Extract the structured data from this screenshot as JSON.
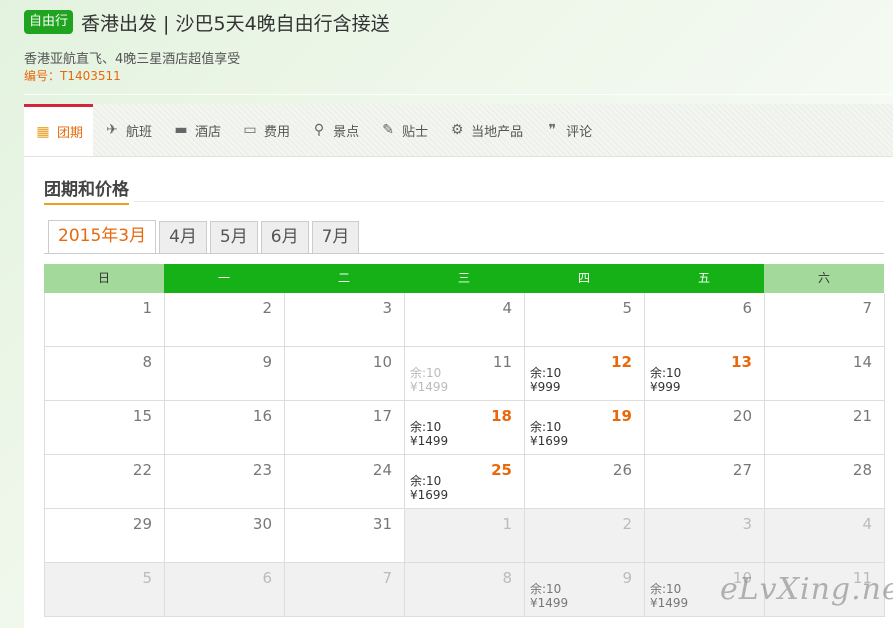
{
  "header": {
    "badge": "自由行",
    "title": "香港出发 | 沙巴5天4晚自由行含接送",
    "subtitle": "香港亚航直飞、4晚三星酒店超值享受",
    "code": "编号：T1403511"
  },
  "tabs": [
    {
      "label": "团期",
      "icon": "calendar-icon"
    },
    {
      "label": "航班",
      "icon": "plane-icon"
    },
    {
      "label": "酒店",
      "icon": "bed-icon"
    },
    {
      "label": "费用",
      "icon": "wallet-icon"
    },
    {
      "label": "景点",
      "icon": "location-pin-icon"
    },
    {
      "label": "贴士",
      "icon": "tips-icon"
    },
    {
      "label": "当地产品",
      "icon": "local-product-icon"
    },
    {
      "label": "评论",
      "icon": "comment-icon"
    }
  ],
  "section": {
    "title": "团期和价格"
  },
  "months": [
    "2015年3月",
    "4月",
    "5月",
    "6月",
    "7月"
  ],
  "weekdays": [
    "日",
    "一",
    "二",
    "三",
    "四",
    "五",
    "六"
  ],
  "calendar": {
    "rows": [
      [
        {
          "day": "1"
        },
        {
          "day": "2"
        },
        {
          "day": "3"
        },
        {
          "day": "4"
        },
        {
          "day": "5"
        },
        {
          "day": "6"
        },
        {
          "day": "7"
        }
      ],
      [
        {
          "day": "8"
        },
        {
          "day": "9"
        },
        {
          "day": "10"
        },
        {
          "day": "11",
          "status": "past",
          "remain": "余:10",
          "price": "¥1499"
        },
        {
          "day": "12",
          "status": "avail",
          "remain": "余:10",
          "price": "¥999"
        },
        {
          "day": "13",
          "status": "avail",
          "remain": "余:10",
          "price": "¥999"
        },
        {
          "day": "14"
        }
      ],
      [
        {
          "day": "15"
        },
        {
          "day": "16"
        },
        {
          "day": "17"
        },
        {
          "day": "18",
          "status": "avail",
          "remain": "余:10",
          "price": "¥1499"
        },
        {
          "day": "19",
          "status": "avail",
          "remain": "余:10",
          "price": "¥1699"
        },
        {
          "day": "20"
        },
        {
          "day": "21"
        }
      ],
      [
        {
          "day": "22"
        },
        {
          "day": "23"
        },
        {
          "day": "24"
        },
        {
          "day": "25",
          "status": "avail",
          "remain": "余:10",
          "price": "¥1699"
        },
        {
          "day": "26"
        },
        {
          "day": "27"
        },
        {
          "day": "28"
        }
      ],
      [
        {
          "day": "29"
        },
        {
          "day": "30"
        },
        {
          "day": "31"
        },
        {
          "day": "1",
          "other": true
        },
        {
          "day": "2",
          "other": true
        },
        {
          "day": "3",
          "other": true
        },
        {
          "day": "4",
          "other": true
        }
      ],
      [
        {
          "day": "5",
          "other": true
        },
        {
          "day": "6",
          "other": true
        },
        {
          "day": "7",
          "other": true
        },
        {
          "day": "8",
          "other": true
        },
        {
          "day": "9",
          "other": true,
          "remain": "余:10",
          "price": "¥1499"
        },
        {
          "day": "10",
          "other": true,
          "remain": "余:10",
          "price": "¥1499"
        },
        {
          "day": "11",
          "other": true
        }
      ]
    ]
  },
  "watermark": "eLvXing.net"
}
